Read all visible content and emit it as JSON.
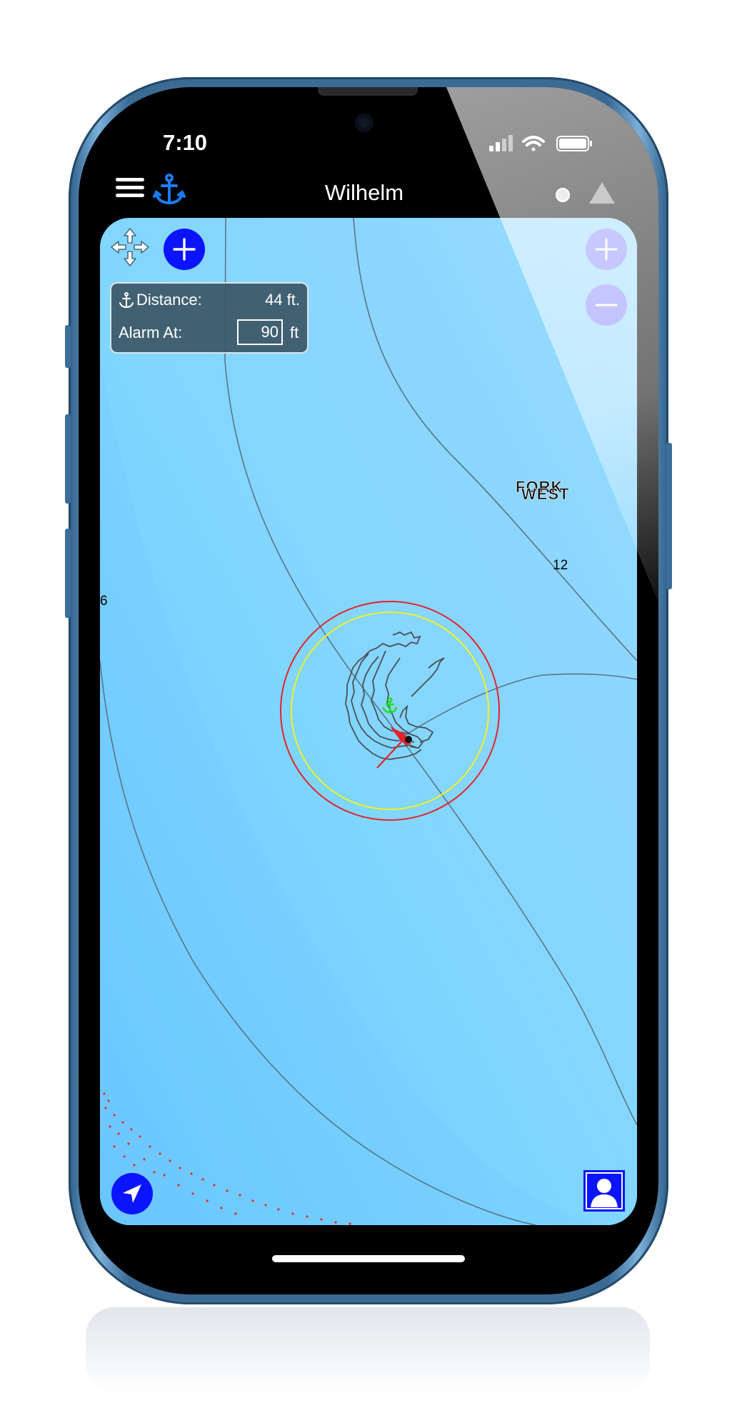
{
  "status_bar": {
    "time": "7:10"
  },
  "nav": {
    "title": "Wilhelm"
  },
  "anchor_panel": {
    "distance_label": "Distance:",
    "distance_value": "44 ft.",
    "alarm_label": "Alarm At:",
    "alarm_value": "90",
    "alarm_unit": "ft"
  },
  "map_labels": {
    "place_name_1": "FORK",
    "place_name_2": "WEST",
    "depth_1": "12",
    "depth_2": "6"
  },
  "colors": {
    "accent_blue": "#0a14ff",
    "zoom_button": "#8a8cff",
    "alarm_ring": "#e8202a",
    "warning_ring": "#eef02a",
    "anchor_marker": "#22dd22",
    "boat": "#e8202a",
    "water": "#7fd3ff"
  },
  "icons": {
    "menu": "hamburger-icon",
    "anchor": "anchor-icon",
    "move": "move-arrows-icon",
    "add": "plus-icon",
    "zoom_in": "plus-icon",
    "zoom_out": "minus-icon",
    "locate": "location-arrow-icon",
    "profile": "person-icon"
  }
}
